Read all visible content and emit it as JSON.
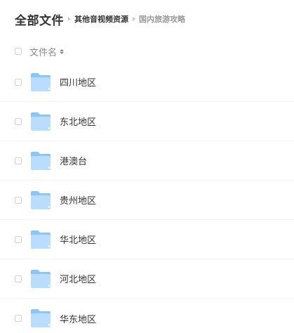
{
  "breadcrumb": {
    "root": "全部文件",
    "parent": "其他音视频资源",
    "current": "国内旅游攻略"
  },
  "list_header": {
    "name_column": "文件名"
  },
  "files": [
    {
      "name": "四川地区",
      "type": "folder-icon"
    },
    {
      "name": "东北地区",
      "type": "folder-icon"
    },
    {
      "name": "港澳台",
      "type": "folder-icon"
    },
    {
      "name": "贵州地区",
      "type": "folder-icon"
    },
    {
      "name": "华北地区",
      "type": "folder-icon"
    },
    {
      "name": "河北地区",
      "type": "folder-icon"
    },
    {
      "name": "华东地区",
      "type": "folder-icon"
    }
  ],
  "colors": {
    "folder_light": "#b9dcff",
    "folder_dark": "#8cc4ff",
    "text": "#333333",
    "muted": "#999999"
  }
}
